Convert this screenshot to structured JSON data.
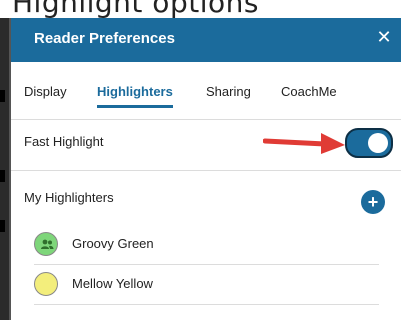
{
  "background_text": "Highlight options",
  "dialog": {
    "title": "Reader Preferences",
    "close_glyph": "✕"
  },
  "tabs": [
    {
      "label": "Display",
      "active": false
    },
    {
      "label": "Highlighters",
      "active": true
    },
    {
      "label": "Sharing",
      "active": false
    },
    {
      "label": "CoachMe",
      "active": false
    }
  ],
  "fast_highlight": {
    "label": "Fast Highlight",
    "enabled": true
  },
  "my_highlighters": {
    "label": "My Highlighters",
    "add_glyph": "+",
    "items": [
      {
        "label": "Groovy Green",
        "color": "#7ed67a",
        "icon": "people-icon"
      },
      {
        "label": "Mellow Yellow",
        "color": "#f3ee7c",
        "icon": ""
      }
    ]
  },
  "colors": {
    "accent": "#1b6b9c",
    "annotation_arrow": "#e03b35"
  }
}
